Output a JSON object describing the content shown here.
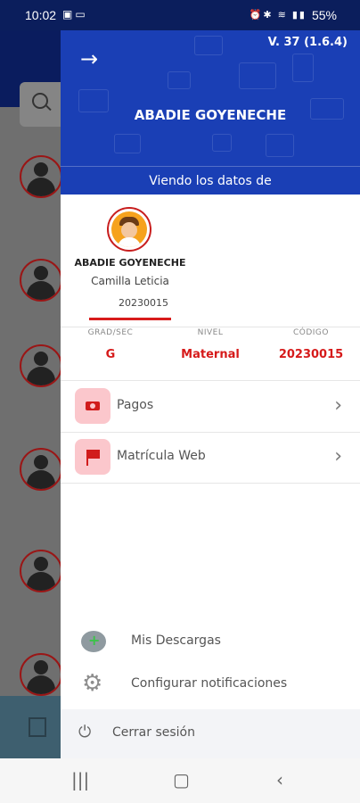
{
  "status_bar": {
    "time": "10:02",
    "battery": "55%"
  },
  "header": {
    "version": "V. 37 (1.6.4)",
    "user_name": "ABADIE GOYENECHE",
    "viewing_label": "Viendo los datos de"
  },
  "student": {
    "name": "ABADIE GOYENECHE",
    "given_names": "Camilla Leticia",
    "code": "20230015"
  },
  "info": [
    {
      "label": "GRAD/SEC",
      "value": "G"
    },
    {
      "label": "NIVEL",
      "value": "Maternal"
    },
    {
      "label": "CÓDIGO",
      "value": "20230015"
    }
  ],
  "menu": [
    {
      "label": "Pagos",
      "icon": "money-icon"
    },
    {
      "label": "Matrícula Web",
      "icon": "flag-icon"
    }
  ],
  "bottom_menu": [
    {
      "label": "Mis Descargas",
      "icon": "cloud-download-icon"
    },
    {
      "label": "Configurar notificaciones",
      "icon": "gear-icon"
    }
  ],
  "logout": {
    "label": "Cerrar sesión"
  },
  "colors": {
    "primary": "#1a3fb5",
    "accent": "#d61a1a",
    "icon_bg": "#fbc7cc"
  }
}
